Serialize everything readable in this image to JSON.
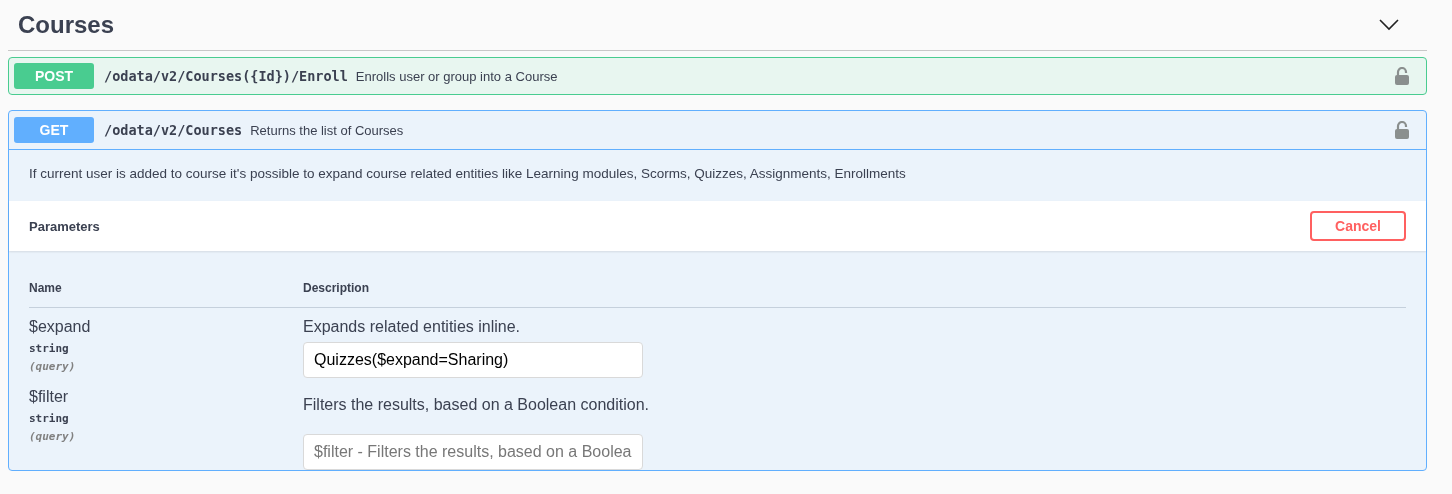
{
  "section": {
    "title": "Courses",
    "expanded": true
  },
  "operations": [
    {
      "kind": "post",
      "method": "POST",
      "path": "/odata/v2/Courses({Id})/Enroll",
      "summary": "Enrolls user or group into a Course",
      "expanded": false
    },
    {
      "kind": "get",
      "method": "GET",
      "path": "/odata/v2/Courses",
      "summary": "Returns the list of Courses",
      "expanded": true,
      "description": "If current user is added to course it's possible to expand course related entities like Learning modules, Scorms, Quizzes, Assignments, Enrollments",
      "parameters_title": "Parameters",
      "cancel_button": "Cancel",
      "columns": [
        "Name",
        "Description"
      ],
      "parameters": [
        {
          "name": "$expand",
          "type": "string",
          "location": "(query)",
          "description": "Expands related entities inline.",
          "value": "Quizzes($expand=Sharing)"
        },
        {
          "name": "$filter",
          "type": "string",
          "location": "(query)",
          "description": "Filters the results, based on a Boolean condition.",
          "placeholder": "$filter - Filters the results, based on a Boolea"
        }
      ]
    }
  ]
}
